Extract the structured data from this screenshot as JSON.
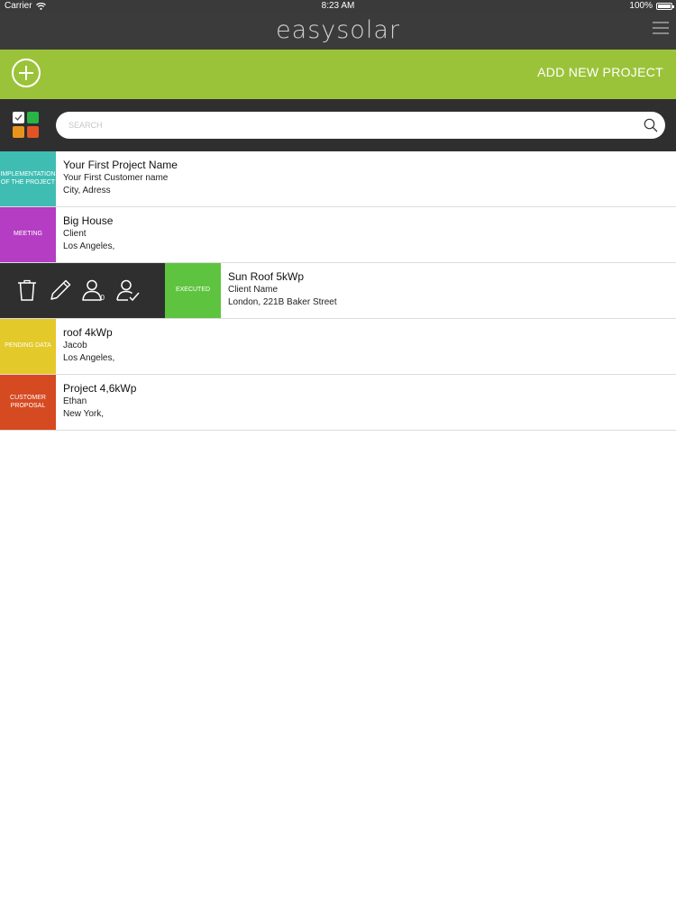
{
  "statusbar": {
    "carrier": "Carrier",
    "time": "8:23 AM",
    "battery": "100%"
  },
  "header": {
    "logo": "easysolar"
  },
  "addbar": {
    "label": "ADD NEW PROJECT"
  },
  "search": {
    "placeholder": "SEARCH"
  },
  "filter_colors": [
    "#ffffff",
    "#28b447",
    "#e8941c",
    "#e25426"
  ],
  "projects": [
    {
      "status": "IMPLEMENTATION OF THE PROJECT",
      "status_color": "#3fbdb3",
      "name": "Your First Project Name",
      "client": "Your First Customer name",
      "address": "City,  Adress"
    },
    {
      "status": "MEETING",
      "status_color": "#b43dc3",
      "name": "Big House",
      "client": "Client",
      "address": "Los Angeles,"
    },
    {
      "status": "EXECUTED",
      "status_color": "#5ec440",
      "name": "Sun Roof 5kWp",
      "client": "Client Name",
      "address": "London,  221B Baker Street"
    },
    {
      "status": "PENDING DATA",
      "status_color": "#e3c92a",
      "name": "roof 4kWp",
      "client": "Jacob",
      "address": "Los Angeles,"
    },
    {
      "status": "CUSTOMER PROPOSAL",
      "status_color": "#d64a22",
      "name": "Project 4,6kWp",
      "client": "Ethan",
      "address": "New York,"
    }
  ],
  "row_actions": {
    "assign_count": "0"
  }
}
